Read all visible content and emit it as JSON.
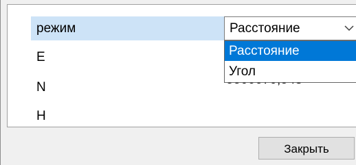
{
  "grid": {
    "rows": [
      {
        "name": "режим",
        "value": ""
      },
      {
        "name": "E",
        "value": ""
      },
      {
        "name": "N",
        "value": "5500670,548"
      },
      {
        "name": "H",
        "value": ""
      }
    ]
  },
  "combo": {
    "selected": "Расстояние",
    "options": [
      "Расстояние",
      "Угол"
    ],
    "highlighted_index": 0
  },
  "footer": {
    "close_label": "Закрыть"
  },
  "colors": {
    "selection_row": "#cde3f7",
    "dropdown_highlight": "#0078d7"
  },
  "icons": {
    "combo_arrow": "chevron-down-icon"
  }
}
